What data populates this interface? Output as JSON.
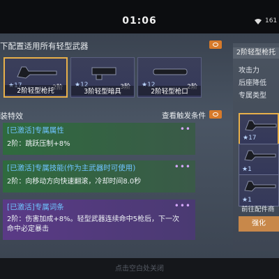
{
  "status": {
    "time": "01:06",
    "battery": "161"
  },
  "header": {
    "title": "下配置适用所有轻型武器"
  },
  "weapons": [
    {
      "stars": "★17",
      "level": "2阶",
      "name": "2阶轻型枪托"
    },
    {
      "stars": "★12",
      "level": "3阶",
      "name": "3阶轻型暗具"
    },
    {
      "stars": "★12",
      "level": "2阶",
      "name": "2阶轻型枪口"
    }
  ],
  "effects_section": {
    "title": "装特效",
    "trigger_label": "查看触发条件"
  },
  "effects": [
    {
      "title": "[已激活]专属属性",
      "dots": "••",
      "desc": "2阶：跳跃压制+8%"
    },
    {
      "title": "[已激活]专属技能(作为主武器时可使用)",
      "dots": "•••",
      "desc": "2阶：向移动方向快速翻滚，冷却时间8.0秒"
    },
    {
      "title": "[已激活]专属词条",
      "dots": "•••",
      "desc_line1": "2阶：伤害加成+8%。轻型武器连续命中5枪后，下一次",
      "desc_line2": "命中必定暴击"
    }
  ],
  "right_panel": {
    "title": "2阶轻型枪托",
    "stats": [
      "攻击力",
      "后座降低",
      "专属类型"
    ],
    "cards": [
      {
        "stars": "★17"
      },
      {
        "stars": "★1"
      },
      {
        "stars": "★1"
      }
    ],
    "link": "前往配件商",
    "button": "强化"
  },
  "bottom_hint": "点击空白处关闭",
  "colors": {
    "accent": "#e8b04a",
    "enhance_button": "#c8884a",
    "eye_button": "#d77a2a",
    "effect_title": "#6fc3ff"
  }
}
